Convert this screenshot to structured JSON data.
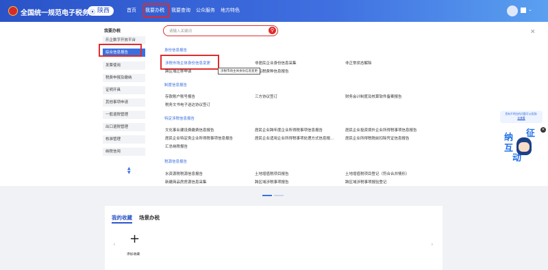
{
  "header": {
    "title": "全国统一规范电子税务局",
    "region": "陕西",
    "nav": [
      "首页",
      "我要办税",
      "我要查询",
      "公众服务",
      "地方特色"
    ],
    "active_nav": "我要办税"
  },
  "menu": {
    "title": "我要办税",
    "items": [
      "乐企数字开放平台",
      "综合信息报告",
      "发票使用",
      "税费申报及缴纳",
      "证明开具",
      "其他事项申请",
      "一般退税管理",
      "出口退税管理",
      "核准管理",
      "纳税信用"
    ],
    "active": "综合信息报告"
  },
  "search": {
    "placeholder": "请输入关键词"
  },
  "sections": {
    "s1": {
      "title": "身份信息报告",
      "links": [
        "涉税市场主体身份信息变更",
        "非居民企业身份信息采集",
        "非正常状态解除",
        "跨区域迁移申请",
        "车船税费种信息报告"
      ]
    },
    "s2": {
      "title": "制度信息报告",
      "links": [
        "存款账户账号报告",
        "三方协议签订",
        "财务会计制度及核算软件备案报告",
        "税务文书电子送达协议签订"
      ]
    },
    "s3": {
      "title": "特定涉税信息报告",
      "links": [
        "文化事业建设费缴费信息报告",
        "居民企业跨年度企业所得税事项信息报告",
        "居民企业投资境外企业所得税事项信息报告",
        "居民企业特定类企业所得税事项信息报告",
        "居民企业适用企业所得税事项处理方式信息报...",
        "居民企业所得税税前扣除凭证信息报告",
        "汇总纳税报告"
      ]
    },
    "s4": {
      "title": "税源信息报告",
      "links": [
        "水资源税税源信息报告",
        "土地增值税项目报告",
        "土地增值税项目登记（符合合并情形）",
        "新建商品房房源信息采集",
        "跨区域涉税事项报告",
        "跨区域涉税事项报验登记"
      ]
    }
  },
  "tooltip": "涉税市场主体身份信息变更",
  "help": {
    "text": "您有不明白的问题可以找我!",
    "link": "去查看"
  },
  "interact": {
    "chars": [
      "征",
      "纳",
      "互",
      "动"
    ]
  },
  "favorites": {
    "tabs": [
      "我的收藏",
      "场景办税"
    ],
    "active_tab": "我的收藏",
    "add_label": "添加收藏"
  },
  "colors": {
    "header_blue": "#2a53c8",
    "accent_blue": "#3b6fe0",
    "red_highlight": "#e02b2b"
  }
}
